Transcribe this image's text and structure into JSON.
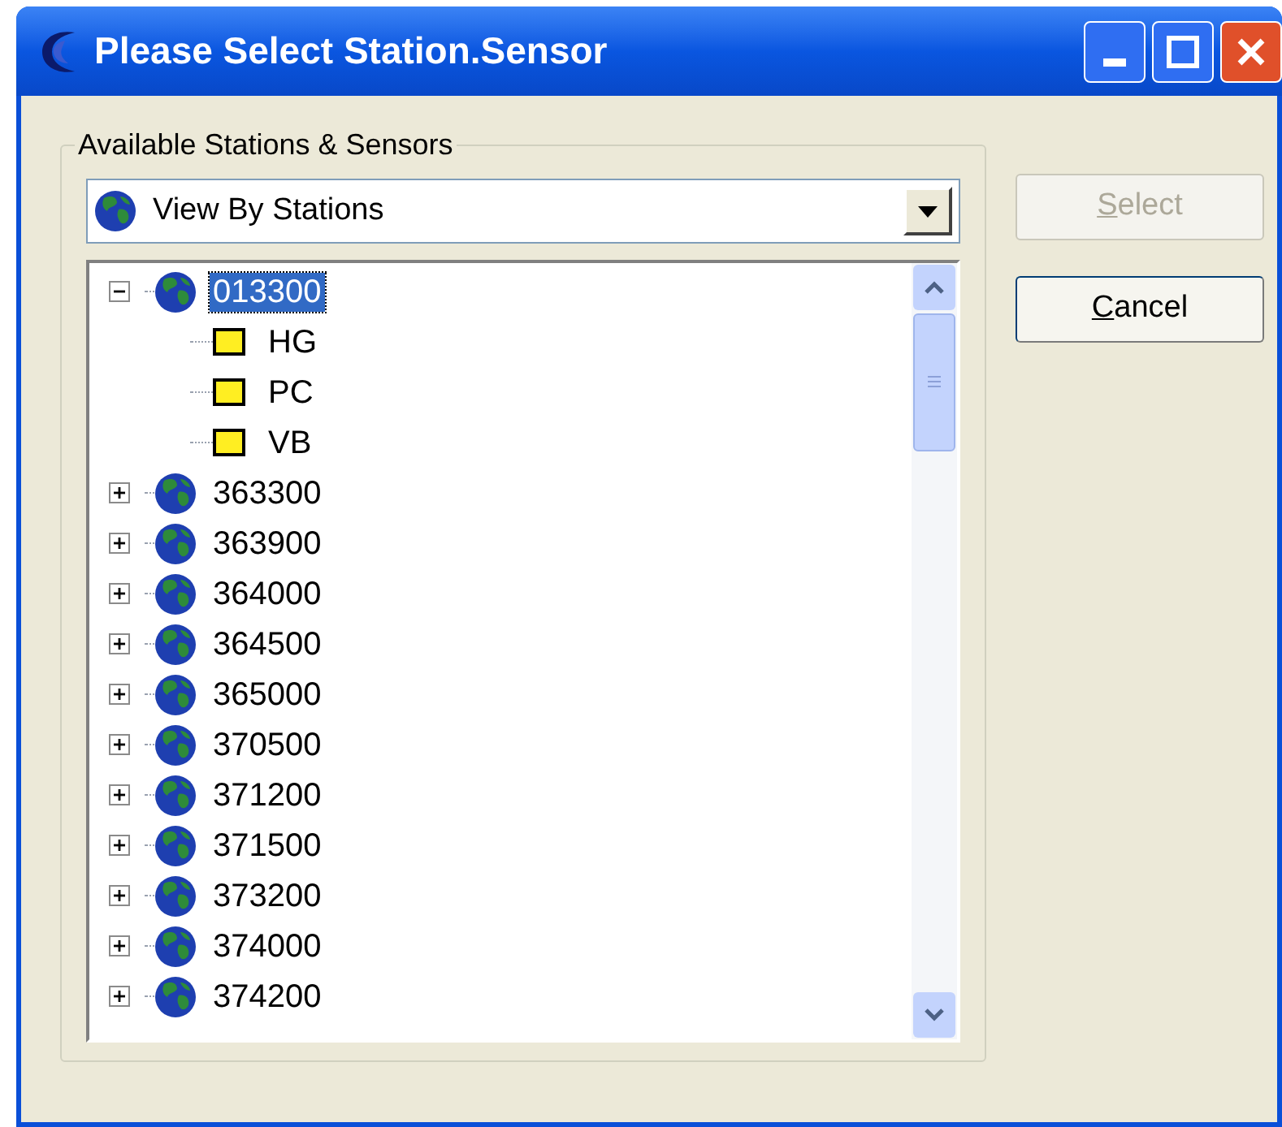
{
  "window": {
    "title": "Please Select Station.Sensor"
  },
  "group": {
    "label": "Available Stations & Sensors"
  },
  "view_dropdown": {
    "value": "View By Stations"
  },
  "tree": [
    {
      "label": "013300",
      "expanded": true,
      "selected": true,
      "children": [
        {
          "label": "HG"
        },
        {
          "label": "PC"
        },
        {
          "label": "VB"
        }
      ]
    },
    {
      "label": "363300",
      "expanded": false,
      "selected": false
    },
    {
      "label": "363900",
      "expanded": false,
      "selected": false
    },
    {
      "label": "364000",
      "expanded": false,
      "selected": false
    },
    {
      "label": "364500",
      "expanded": false,
      "selected": false
    },
    {
      "label": "365000",
      "expanded": false,
      "selected": false
    },
    {
      "label": "370500",
      "expanded": false,
      "selected": false
    },
    {
      "label": "371200",
      "expanded": false,
      "selected": false
    },
    {
      "label": "371500",
      "expanded": false,
      "selected": false
    },
    {
      "label": "373200",
      "expanded": false,
      "selected": false
    },
    {
      "label": "374000",
      "expanded": false,
      "selected": false
    },
    {
      "label": "374200",
      "expanded": false,
      "selected": false
    }
  ],
  "buttons": [
    {
      "label": "Select",
      "disabled": true
    },
    {
      "label": "Cancel",
      "disabled": false
    }
  ]
}
